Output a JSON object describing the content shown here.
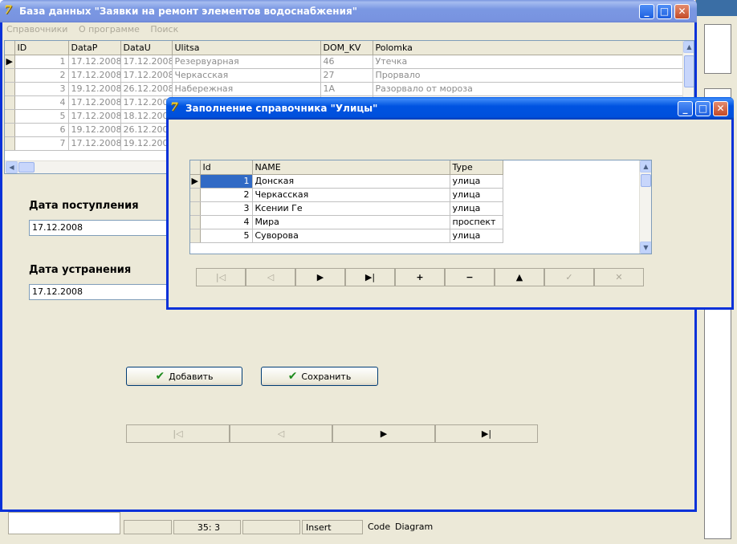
{
  "ide": {
    "status": {
      "position": "35:  3",
      "mode": "Insert"
    },
    "tabs": [
      "Code",
      "Diagram"
    ]
  },
  "main_window": {
    "title": "База данных \"Заявки на ремонт элементов водоснабжения\"",
    "menu": [
      "Справочники",
      "О программе",
      "Поиск"
    ],
    "grid": {
      "columns": [
        "ID",
        "DataP",
        "DataU",
        "Ulitsa",
        "DOM_KV",
        "Polomka"
      ],
      "rows": [
        [
          "1",
          "17.12.2008",
          "17.12.2008",
          "Резервуарная",
          "46",
          "Утечка"
        ],
        [
          "2",
          "17.12.2008",
          "17.12.2008",
          "Черкасская",
          "27",
          "Прорвало"
        ],
        [
          "3",
          "19.12.2008",
          "26.12.2008",
          "Набережная",
          "1А",
          "Разорвало от мороза"
        ],
        [
          "4",
          "17.12.2008",
          "17.12.2008",
          "",
          "",
          ""
        ],
        [
          "5",
          "17.12.2008",
          "18.12.2008",
          "",
          "",
          ""
        ],
        [
          "6",
          "19.12.2008",
          "26.12.2008",
          "",
          "",
          ""
        ],
        [
          "7",
          "17.12.2008",
          "19.12.2008",
          "",
          "",
          ""
        ]
      ]
    },
    "date_received_label": "Дата поступления",
    "date_received_value": "17.12.2008",
    "date_fixed_label": "Дата устранения",
    "date_fixed_value": "17.12.2008",
    "add_button": "Добавить",
    "save_button": "Сохранить",
    "nav": {
      "first": "|◁",
      "prior": "◁",
      "next": "▶",
      "last": "▶|"
    }
  },
  "streets_window": {
    "title": "Заполнение справочника \"Улицы\"",
    "grid": {
      "columns": [
        "Id",
        "NAME",
        "Type"
      ],
      "rows": [
        [
          "1",
          "Донская",
          "улица"
        ],
        [
          "2",
          "Черкасская",
          "улица"
        ],
        [
          "3",
          "Ксении Ге",
          "улица"
        ],
        [
          "4",
          "Мира",
          "проспект"
        ],
        [
          "5",
          "Суворова",
          "улица"
        ]
      ]
    },
    "nav": {
      "first": "|◁",
      "prior": "◁",
      "next": "▶",
      "last": "▶|",
      "insert": "+",
      "delete": "−",
      "edit": "▲",
      "post": "✓",
      "cancel": "✕"
    }
  }
}
